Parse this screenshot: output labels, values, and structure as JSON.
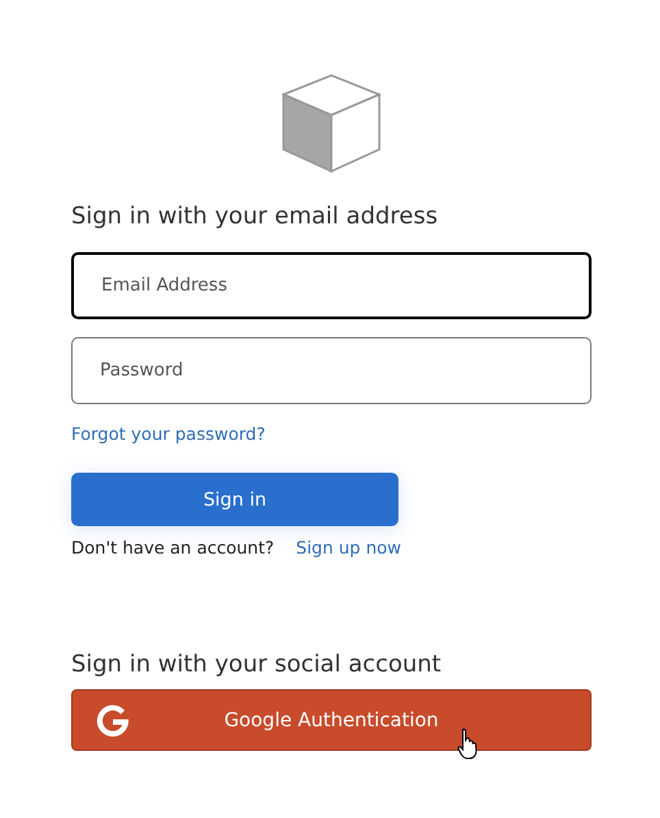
{
  "email_section": {
    "heading": "Sign in with your email address"
  },
  "fields": [
    {
      "placeholder": "Email Address",
      "focused": true
    },
    {
      "placeholder": "Password",
      "focused": false
    }
  ],
  "forgot_link": "Forgot your password?",
  "sign_in_button": "Sign in",
  "signup": {
    "prompt": "Don't have an account?",
    "link": "Sign up now"
  },
  "social_section": {
    "heading": "Sign in with your social account",
    "button": "Google Authentication"
  }
}
